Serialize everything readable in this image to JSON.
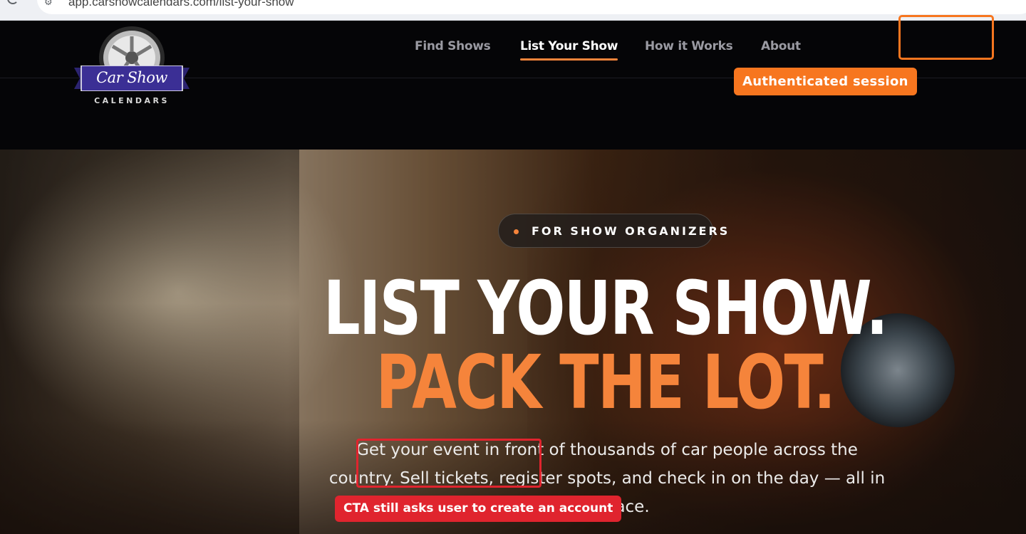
{
  "browser": {
    "url": "app.carshowcalendars.com/list-your-show"
  },
  "logo": {
    "script": "Car Show",
    "subtitle": "CALENDARS"
  },
  "nav": {
    "items": [
      {
        "label": "Find Shows",
        "active": false
      },
      {
        "label": "List Your Show",
        "active": true
      },
      {
        "label": "How it Works",
        "active": false
      },
      {
        "label": "About",
        "active": false
      }
    ]
  },
  "annotations": {
    "auth_label": "Authenticated session",
    "cta_label": "CTA still asks user to create an account"
  },
  "hero": {
    "badge": "FOR SHOW ORGANIZERS",
    "headline_1": "LIST YOUR SHOW.",
    "headline_2": "PACK THE LOT.",
    "subtext": "Get your event in front of thousands of car people across the country. Sell tickets, register spots, and check in on the day — all in one place."
  },
  "colors": {
    "accent": "#f5843b",
    "annotation_orange": "#f7761f",
    "annotation_red": "#e0242e",
    "header_bg": "#050507"
  }
}
